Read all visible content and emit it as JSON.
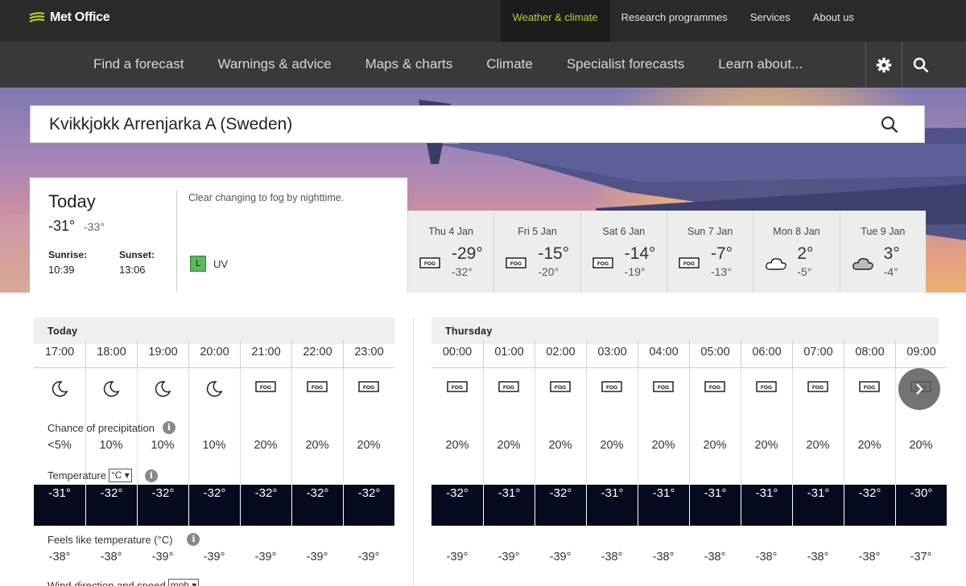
{
  "brand": {
    "name": "Met Office"
  },
  "topnav": [
    {
      "label": "Weather & climate",
      "active": true
    },
    {
      "label": "Research programmes",
      "active": false
    },
    {
      "label": "Services",
      "active": false
    },
    {
      "label": "About us",
      "active": false
    }
  ],
  "mainnav": [
    "Find a forecast",
    "Warnings & advice",
    "Maps & charts",
    "Climate",
    "Specialist forecasts",
    "Learn about..."
  ],
  "search": {
    "value": "Kvikkjokk Arrenjarka A (Sweden)"
  },
  "today": {
    "title": "Today",
    "max": "-31°",
    "min": "-33°",
    "sunrise_label": "Sunrise:",
    "sunrise": "10:39",
    "sunset_label": "Sunset:",
    "sunset": "13:06",
    "summary": "Clear changing to fog by nighttime.",
    "uv_level": "L",
    "uv_label": "UV"
  },
  "days": [
    {
      "name": "Thu 4 Jan",
      "icon": "fog",
      "max": "-29°",
      "min": "-32°"
    },
    {
      "name": "Fri 5 Jan",
      "icon": "fog",
      "max": "-15°",
      "min": "-20°"
    },
    {
      "name": "Sat 6 Jan",
      "icon": "fog",
      "max": "-14°",
      "min": "-19°"
    },
    {
      "name": "Sun 7 Jan",
      "icon": "fog",
      "max": "-7°",
      "min": "-13°"
    },
    {
      "name": "Mon 8 Jan",
      "icon": "cloud",
      "max": "2°",
      "min": "-5°"
    },
    {
      "name": "Tue 9 Jan",
      "icon": "cloudy",
      "max": "3°",
      "min": "-4°"
    }
  ],
  "hourly": {
    "rows": {
      "precip_label": "Chance of precipitation",
      "temp_label": "Temperature",
      "temp_unit": "°C",
      "feels_label": "Feels like temperature (°C)",
      "wind_label": "Wind direction and speed",
      "wind_unit": "mph"
    },
    "today": {
      "label": "Today",
      "times": [
        "17:00",
        "18:00",
        "19:00",
        "20:00",
        "21:00",
        "22:00",
        "23:00"
      ],
      "icons": [
        "clear-night",
        "clear-night",
        "clear-night",
        "clear-night",
        "fog",
        "fog",
        "fog"
      ],
      "precip": [
        "<5%",
        "10%",
        "10%",
        "10%",
        "20%",
        "20%",
        "20%"
      ],
      "temp": [
        "-31°",
        "-32°",
        "-32°",
        "-32°",
        "-32°",
        "-32°",
        "-32°"
      ],
      "feels": [
        "-38°",
        "-38°",
        "-39°",
        "-39°",
        "-39°",
        "-39°",
        "-39°"
      ]
    },
    "thursday": {
      "label": "Thursday",
      "times": [
        "00:00",
        "01:00",
        "02:00",
        "03:00",
        "04:00",
        "05:00",
        "06:00",
        "07:00",
        "08:00",
        "09:00"
      ],
      "icons": [
        "fog",
        "fog",
        "fog",
        "fog",
        "fog",
        "fog",
        "fog",
        "fog",
        "fog",
        "fog"
      ],
      "precip": [
        "20%",
        "20%",
        "20%",
        "20%",
        "20%",
        "20%",
        "20%",
        "20%",
        "20%",
        "20%"
      ],
      "temp": [
        "-32°",
        "-31°",
        "-32°",
        "-31°",
        "-31°",
        "-31°",
        "-31°",
        "-31°",
        "-32°",
        "-30°"
      ],
      "feels": [
        "-39°",
        "-39°",
        "-39°",
        "-38°",
        "-38°",
        "-38°",
        "-38°",
        "-38°",
        "-38°",
        "-37°"
      ]
    }
  },
  "icon_labels": {
    "fog": "FOG",
    "info": "i"
  },
  "colors": {
    "accent": "#b6d334",
    "temp_cell": "#050a1e",
    "uv_low": "#5cb85c"
  }
}
